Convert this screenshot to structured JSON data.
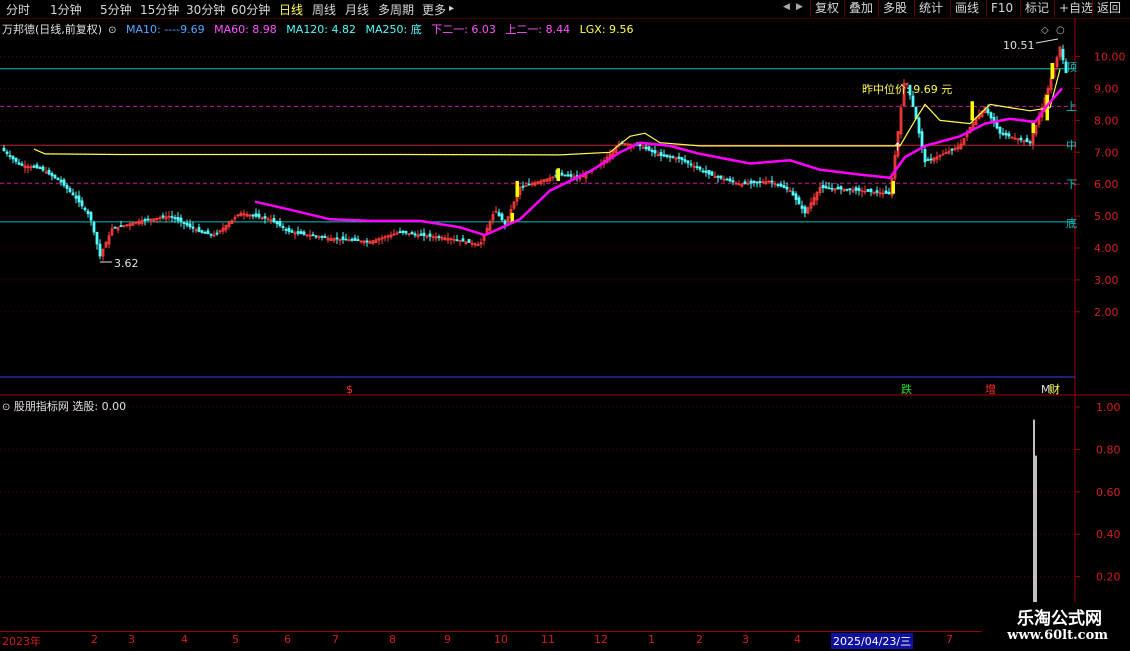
{
  "toolbar": {
    "periods": [
      "分时",
      "1分钟",
      "5分钟",
      "15分钟",
      "30分钟",
      "60分钟",
      "日线",
      "周线",
      "月线",
      "多周期",
      "更多"
    ],
    "more_suffix": "▸",
    "active_period": "日线",
    "scroll_left": "◀",
    "scroll_right": "▶",
    "buttons": [
      "复权",
      "叠加",
      "多股",
      "统计",
      "画线",
      "F10",
      "+自选",
      "返回"
    ]
  },
  "indicator_line": {
    "stock": "万邦德(日线,前复权)",
    "ma10": "MA10: ----9.69",
    "ma60": "MA60: 8.98",
    "ma120": "MA120: 4.82",
    "ma250": "MA250: 底",
    "lower": "下二一: 6.03",
    "upper": "上二一: 8.44",
    "lgx": "LGX: 9.56",
    "settings_icon": "circle-icon"
  },
  "price_axis": [
    "10.00",
    "9.00",
    "8.00",
    "7.00",
    "6.00",
    "5.00",
    "4.00",
    "3.00",
    "2.00"
  ],
  "price_levels": {
    "top": 9.62,
    "upper": 8.44,
    "mid": 7.22,
    "lower": 6.03,
    "bottom": 4.82
  },
  "level_labels": {
    "top": "顶",
    "upper": "上",
    "mid": "中",
    "lower": "下",
    "bottom": "底"
  },
  "annotations": {
    "high_label": "10.51",
    "low_label": "3.62",
    "yesterday_mid": "昨中位价: 9.69 元",
    "event_dollar": "$",
    "event_fall": "跌",
    "event_increase": "增",
    "event_finance": "财",
    "event_prefix": "M"
  },
  "sub_panel": {
    "indicator_name": "股朋指标网",
    "select_label": "选股: 0.00",
    "axis": [
      "1.00",
      "0.80",
      "0.60",
      "0.40",
      "0.20"
    ]
  },
  "date_axis": {
    "labels": [
      "2023年",
      "2",
      "3",
      "4",
      "5",
      "6",
      "7",
      "8",
      "9",
      "10",
      "11",
      "12",
      "1",
      "2",
      "3",
      "4",
      "7"
    ],
    "highlight": "2025/04/23/三"
  },
  "watermark": {
    "line1": "乐淘公式网",
    "line2": "www.60lt.com"
  },
  "colors": {
    "up": "#ff3c3c",
    "down": "#54fcfc",
    "ma_yellow": "#ffff54",
    "ma_magenta": "#ff00ff",
    "level_cyan": "#00c0c0",
    "level_dash": "#c0209a",
    "mid_red": "#c02828",
    "signal": "#ffff00"
  }
}
